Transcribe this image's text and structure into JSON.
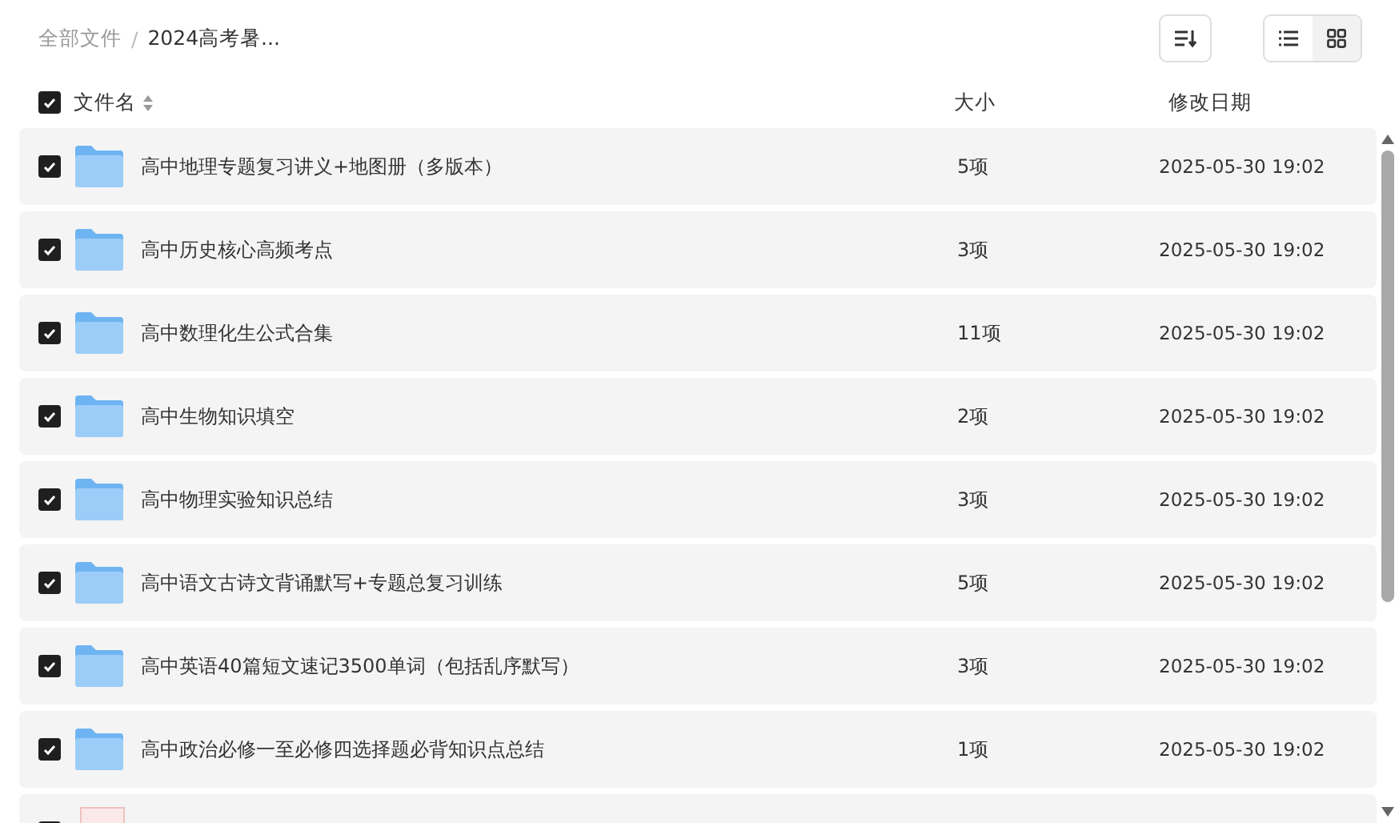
{
  "breadcrumb_separator": "/",
  "breadcrumb": [
    {
      "label": "全部文件",
      "current": false
    },
    {
      "label": "2024高考暑...",
      "current": true
    }
  ],
  "view_modes": [
    {
      "kind": "list",
      "selected": false
    },
    {
      "kind": "grid",
      "selected": true
    }
  ],
  "table": {
    "select_all": {
      "checked": true
    },
    "columns": [
      "文件名",
      "大小",
      "修改日期"
    ],
    "rows": [
      {
        "name": "高中地理专题复习讲义+地图册（多版本）",
        "size": "5项",
        "modified": "2025-05-30 19:02",
        "checked": true,
        "kind": "folder"
      },
      {
        "name": "高中历史核心高频考点",
        "size": "3项",
        "modified": "2025-05-30 19:02",
        "checked": true,
        "kind": "folder"
      },
      {
        "name": "高中数理化生公式合集",
        "size": "11项",
        "modified": "2025-05-30 19:02",
        "checked": true,
        "kind": "folder"
      },
      {
        "name": "高中生物知识填空",
        "size": "2项",
        "modified": "2025-05-30 19:02",
        "checked": true,
        "kind": "folder"
      },
      {
        "name": "高中物理实验知识总结",
        "size": "3项",
        "modified": "2025-05-30 19:02",
        "checked": true,
        "kind": "folder"
      },
      {
        "name": "高中语文古诗文背诵默写+专题总复习训练",
        "size": "5项",
        "modified": "2025-05-30 19:02",
        "checked": true,
        "kind": "folder"
      },
      {
        "name": "高中英语40篇短文速记3500单词（包括乱序默写）",
        "size": "3项",
        "modified": "2025-05-30 19:02",
        "checked": true,
        "kind": "folder"
      },
      {
        "name": "高中政治必修一至必修四选择题必背知识点总结",
        "size": "1项",
        "modified": "2025-05-30 19:02",
        "checked": true,
        "kind": "folder"
      },
      {
        "checked": true,
        "kind": "document"
      }
    ]
  }
}
